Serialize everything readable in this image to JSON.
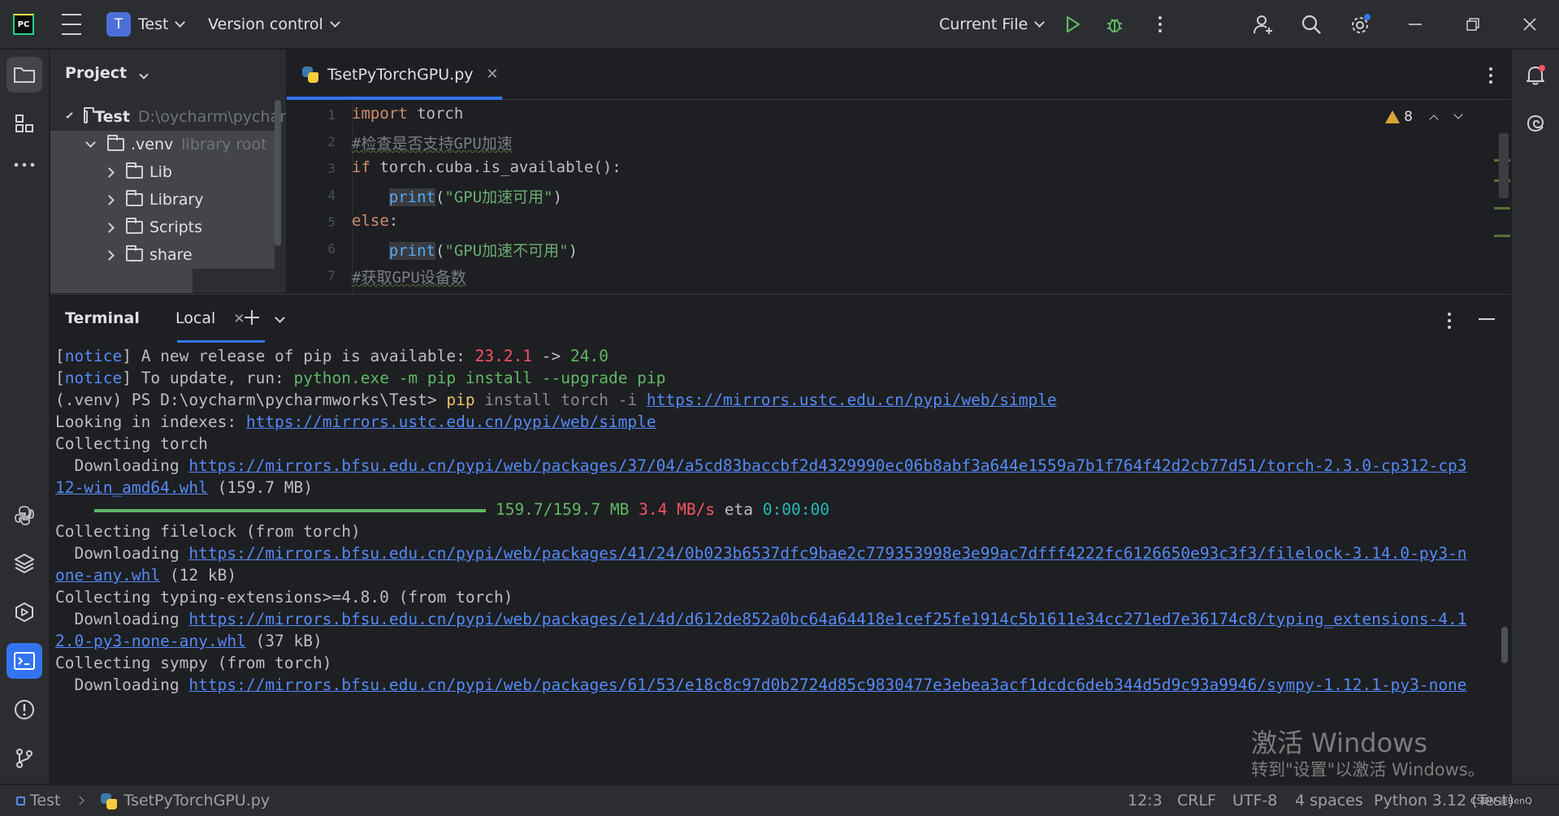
{
  "titlebar": {
    "logo_text": "PC",
    "project_initial": "T",
    "project_name": "Test",
    "vcs_label": "Version control",
    "run_config": "Current File"
  },
  "project_panel": {
    "title": "Project",
    "tree": [
      {
        "label": "Test",
        "note": "D:\\oycharm\\pychar"
      },
      {
        "label": ".venv",
        "note": "library root"
      },
      {
        "label": "Lib"
      },
      {
        "label": "Library"
      },
      {
        "label": "Scripts"
      },
      {
        "label": "share"
      }
    ]
  },
  "editor": {
    "tab_label": "TsetPyTorchGPU.py",
    "warnings_count": "8",
    "line_numbers": [
      "1",
      "2",
      "3",
      "4",
      "5",
      "6",
      "7"
    ],
    "lines": [
      {
        "kw": "import",
        "rest": " torch"
      },
      {
        "comment": "#检查是否支持GPU加速"
      },
      {
        "kw": "if",
        "rest": " torch.cuba.is_available():"
      },
      {
        "indent": "    ",
        "fn": "print",
        "open": "(",
        "str": "\"GPU加速可用\"",
        "close": ")"
      },
      {
        "kw": "else",
        "rest": ":"
      },
      {
        "indent": "    ",
        "fn": "print",
        "open": "(",
        "str": "\"GPU加速不可用\"",
        "close": ")"
      },
      {
        "comment": "#获取GPU设备数"
      }
    ]
  },
  "terminal": {
    "title": "Terminal",
    "tab_label": "Local",
    "lines": {
      "l1": {
        "open": "[",
        "notice": "notice",
        "close": "]",
        "text": " A new release of pip is available: ",
        "old": "23.2.1",
        "arrow": " -> ",
        "new": "24.0"
      },
      "l2": {
        "open": "[",
        "notice": "notice",
        "close": "]",
        "text": " To update, run: ",
        "cmd": "python.exe -m pip install --upgrade pip"
      },
      "l3": {
        "prompt": "(.venv) PS D:\\oycharm\\pycharmworks\\Test> ",
        "pip": "pip",
        "args": " install torch -i ",
        "url": "https://mirrors.ustc.edu.cn/pypi/web/simple"
      },
      "l4": {
        "text": "Looking in indexes: ",
        "url": "https://mirrors.ustc.edu.cn/pypi/web/simple"
      },
      "l5": "Collecting torch",
      "l6": {
        "text": "  Downloading ",
        "url": "https://mirrors.bfsu.edu.cn/pypi/web/packages/37/04/a5cd83baccbf2d4329990ec06b8abf3a644e1559a7b1f764f42d2cb77d51/torch-2.3.0-cp312-cp3"
      },
      "l7": {
        "url": "12-win_amd64.whl",
        "text": " (159.7 MB)"
      },
      "l8": {
        "size": "159.7/159.7 MB",
        "speed": "3.4 MB/s",
        "eta_label": "eta",
        "eta": "0:00:00"
      },
      "l9": "Collecting filelock (from torch)",
      "l10": {
        "text": "  Downloading ",
        "url": "https://mirrors.bfsu.edu.cn/pypi/web/packages/41/24/0b023b6537dfc9bae2c779353998e3e99ac7dfff4222fc6126650e93c3f3/filelock-3.14.0-py3-n"
      },
      "l11": {
        "url": "one-any.whl",
        "text": " (12 kB)"
      },
      "l12": "Collecting typing-extensions>=4.8.0 (from torch)",
      "l13": {
        "text": "  Downloading ",
        "url": "https://mirrors.bfsu.edu.cn/pypi/web/packages/e1/4d/d612de852a0bc64a64418e1cef25fe1914c5b1611e34cc271ed7e36174c8/typing_extensions-4.1"
      },
      "l14": {
        "url": "2.0-py3-none-any.whl",
        "text": " (37 kB)"
      },
      "l15": "Collecting sympy (from torch)",
      "l16": {
        "text": "  Downloading ",
        "url": "https://mirrors.bfsu.edu.cn/pypi/web/packages/61/53/e18c8c97d0b2724d85c9830477e3ebea3acf1dcdc6deb344d5d9c93a9946/sympy-1.12.1-py3-none"
      }
    }
  },
  "watermark": {
    "line1": "激活 Windows",
    "line2": "转到\"设置\"以激活 Windows。"
  },
  "statusbar": {
    "project": "Test",
    "file": "TsetPyTorchGPU.py",
    "position": "12:3",
    "line_ending": "CRLF",
    "encoding": "UTF-8",
    "indent": "4 spaces",
    "interpreter": "Python 3.12 (Test)",
    "csdn": "CSDN @BenQ"
  },
  "colors": {
    "accent": "#3574f0",
    "background": "#1e1f22",
    "panel": "#2b2d30"
  }
}
